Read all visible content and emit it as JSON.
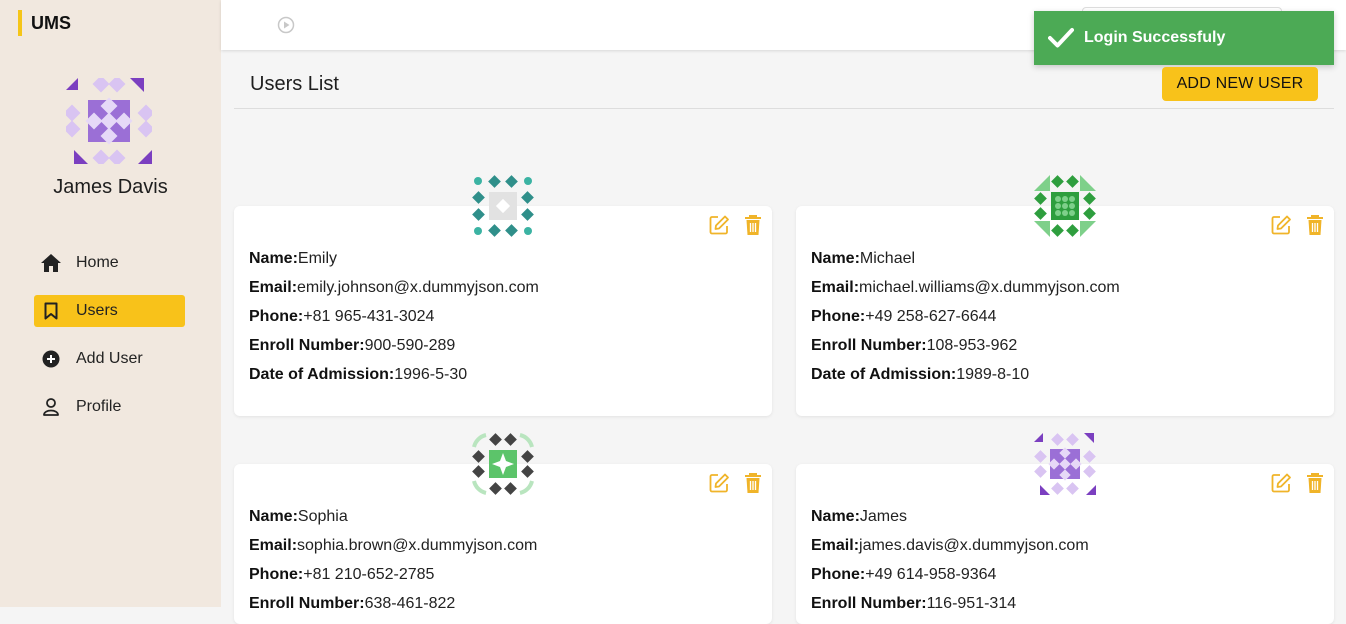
{
  "app": {
    "brand": "UMS"
  },
  "sidebar": {
    "user_name": "James Davis",
    "items": [
      {
        "label": "Home",
        "icon": "home-icon"
      },
      {
        "label": "Users",
        "icon": "bookmark-icon",
        "active": true
      },
      {
        "label": "Add User",
        "icon": "plus-circle-icon"
      },
      {
        "label": "Profile",
        "icon": "person-icon"
      }
    ]
  },
  "toast": {
    "message": "Login Successfuly",
    "color": "#4caa55"
  },
  "main": {
    "title": "Users List",
    "add_button": "ADD NEW USER"
  },
  "labels": {
    "name": "Name:",
    "email": "Email:",
    "phone": "Phone:",
    "enroll": "Enroll Number:",
    "admission": "Date of Admission:"
  },
  "users": [
    {
      "name": "Emily",
      "email": "emily.johnson@x.dummyjson.com",
      "phone": "+81 965-431-3024",
      "enroll": "900-590-289",
      "admission": "1996-5-30",
      "avatar_color": "#3bb3a3"
    },
    {
      "name": "Michael",
      "email": "michael.williams@x.dummyjson.com",
      "phone": "+49 258-627-6644",
      "enroll": "108-953-962",
      "admission": "1989-8-10",
      "avatar_color": "#2e9e3e"
    },
    {
      "name": "Sophia",
      "email": "sophia.brown@x.dummyjson.com",
      "phone": "+81 210-652-2785",
      "enroll": "638-461-822",
      "admission": "",
      "avatar_color": "#5cc46a"
    },
    {
      "name": "James",
      "email": "james.davis@x.dummyjson.com",
      "phone": "+49 614-958-9364",
      "enroll": "116-951-314",
      "admission": "",
      "avatar_color": "#8a4fc4"
    }
  ],
  "colors": {
    "accent": "#f8c21a",
    "sidebar_bg": "#f1e8df",
    "icon_yellow": "#f0b429"
  }
}
